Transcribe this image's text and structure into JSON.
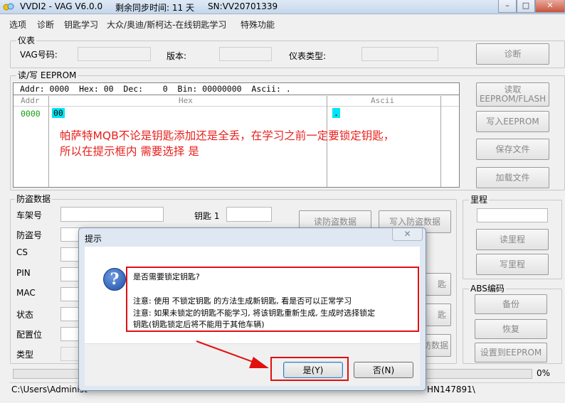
{
  "titlebar": {
    "app": "VVDI2 - VAG V6.0.0",
    "sync": "剩余同步时间: 11 天",
    "sn": "SN:VV20701339"
  },
  "menu": [
    "选项",
    "诊断",
    "钥匙学习",
    "大众/奥迪/斯柯达-在线钥匙学习",
    "特殊功能"
  ],
  "instrument": {
    "legend": "仪表",
    "vag_label": "VAG号码:",
    "version_label": "版本:",
    "type_label": "仪表类型:",
    "diag_button": "诊断"
  },
  "eeprom": {
    "legend": "读/写 EEPROM",
    "status": "Addr: 0000  Hex: 00  Dec:    0  Bin: 00000000  Ascii: .",
    "col_addr": "Addr",
    "col_hex": "Hex",
    "col_ascii": "Ascii",
    "row_addr": "0000",
    "row_hex": "00",
    "row_ascii": ".",
    "buttons": {
      "read": "读取\nEEPROM/FLASH",
      "write": "写入EEPROM",
      "save": "保存文件",
      "load": "加载文件"
    }
  },
  "annotation": {
    "line1": "帕萨特MQB不论是钥匙添加还是全丢，在学习之前一定要锁定钥匙，",
    "line2": "所以在提示框内 需要选择 是"
  },
  "immo": {
    "legend": "防盗数据",
    "labels": [
      "车架号",
      "防盗号",
      "CS",
      "PIN",
      "MAC",
      "状态",
      "配置位",
      "类型"
    ],
    "key1_label": "钥匙 1",
    "read_button": "读防盗数据",
    "write_button": "写入防盗数据",
    "partial_buttons": [
      "匙",
      "匙",
      "防数据"
    ]
  },
  "mileage": {
    "legend": "里程",
    "read_button": "读里程",
    "write_button": "写里程"
  },
  "abs": {
    "legend": "ABS编码",
    "backup_button": "备份",
    "restore_button": "恢复",
    "set_button": "设置到EEPROM"
  },
  "progress": {
    "value": 0,
    "label": "0%"
  },
  "status": {
    "path_left": "C:\\Users\\Administ",
    "path_right": "HN147891\\"
  },
  "dialog": {
    "title": "提示",
    "close_glyph": "✕",
    "icon_glyph": "?",
    "lines": [
      "是否需要锁定钥匙?",
      "注意: 使用 不锁定钥匙 的方法生成新钥匙, 看是否可以正常学习",
      "注意: 如果未锁定的钥匙不能学习, 将该钥匙重新生成, 生成时选择锁定",
      "钥匙(钥匙锁定后将不能用于其他车辆)"
    ],
    "yes_button": "是(Y)",
    "no_button": "否(N)"
  },
  "colors": {
    "annotation": "#e8201c",
    "highlight_box": "#e01010",
    "addr_text": "#10a010",
    "cell_select": "#00e5f5"
  }
}
